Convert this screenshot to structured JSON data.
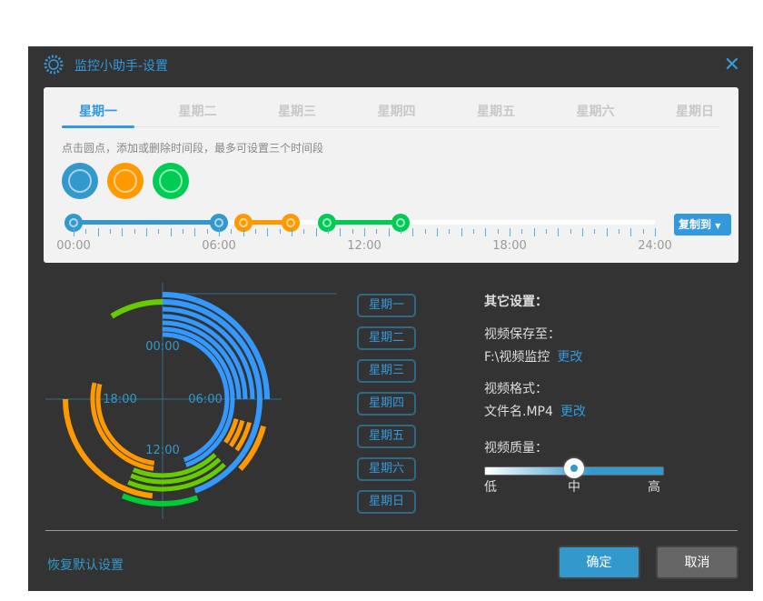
{
  "window": {
    "title": "监控小助手-设置",
    "icon": "gear-icon",
    "close_icon": "close-icon"
  },
  "tabs": [
    {
      "label": "星期一",
      "active": true
    },
    {
      "label": "星期二"
    },
    {
      "label": "星期三"
    },
    {
      "label": "星期四"
    },
    {
      "label": "星期五"
    },
    {
      "label": "星期六"
    },
    {
      "label": "星期日"
    }
  ],
  "hint": "点击圆点，添加或删除时间段，最多可设置三个时间段",
  "colors": {
    "accent": "#3399dd",
    "blue": "#3399cc",
    "orange": "#ff9900",
    "green": "#00cc55",
    "ring_blue": "#3399ff",
    "ring_orange": "#ff9900",
    "ring_lime": "#66cc00",
    "ring_green": "#00cc33"
  },
  "period_dots": [
    {
      "color": "#3399cc"
    },
    {
      "color": "#ff9900"
    },
    {
      "color": "#00cc55"
    }
  ],
  "timeline": {
    "segments": [
      {
        "start": 0,
        "end": 6,
        "color": "#3399cc"
      },
      {
        "start": 7,
        "end": 8.95,
        "color": "#ff9900"
      },
      {
        "start": 10.45,
        "end": 13.5,
        "color": "#00cc55"
      }
    ],
    "labels": [
      "00:00",
      "06:00",
      "12:00",
      "18:00",
      "24:00"
    ]
  },
  "copy_button": "复制到",
  "chart_data": {
    "type": "radial-schedule",
    "center_labels": [
      "00:00",
      "06:00",
      "12:00",
      "18:00"
    ],
    "rings": [
      {
        "day": "星期一",
        "arcs": [
          {
            "start": 0,
            "end": 6,
            "color": "#3399ff"
          },
          {
            "start": 7,
            "end": 8.8,
            "color": "#ff9900"
          },
          {
            "start": 10.7,
            "end": 13.5,
            "color": "#00cc33"
          }
        ]
      },
      {
        "day": "星期二",
        "arcs": [
          {
            "start": 0,
            "end": 10.7,
            "color": "#3399ff"
          },
          {
            "start": 12.4,
            "end": 18,
            "color": "#ff9900"
          },
          {
            "start": 21.9,
            "end": 24,
            "color": "#66cc00"
          }
        ]
      },
      {
        "day": "星期三",
        "arcs": [
          {
            "start": 0,
            "end": 6,
            "color": "#3399ff"
          },
          {
            "start": 7,
            "end": 8.3,
            "color": "#ff9900"
          },
          {
            "start": 9.1,
            "end": 13.5,
            "color": "#66cc00"
          }
        ]
      },
      {
        "day": "星期四",
        "arcs": [
          {
            "start": 0,
            "end": 6,
            "color": "#3399ff"
          },
          {
            "start": 7,
            "end": 8.3,
            "color": "#ff9900"
          },
          {
            "start": 9.1,
            "end": 13.5,
            "color": "#66cc00"
          }
        ]
      },
      {
        "day": "星期五",
        "arcs": [
          {
            "start": 0,
            "end": 6,
            "color": "#3399ff"
          },
          {
            "start": 7,
            "end": 8.3,
            "color": "#ff9900"
          },
          {
            "start": 9.1,
            "end": 13.5,
            "color": "#66cc00"
          }
        ]
      },
      {
        "day": "星期六",
        "arcs": [
          {
            "start": 0,
            "end": 10.7,
            "color": "#3399ff"
          },
          {
            "start": 12.5,
            "end": 18.9,
            "color": "#ff9900"
          }
        ]
      },
      {
        "day": "星期日",
        "arcs": [
          {
            "start": 0,
            "end": 10.7,
            "color": "#3399ff"
          },
          {
            "start": 12.5,
            "end": 18.9,
            "color": "#ff9900"
          }
        ]
      }
    ]
  },
  "day_buttons": [
    "星期一",
    "星期二",
    "星期三",
    "星期四",
    "星期五",
    "星期六",
    "星期日"
  ],
  "other": {
    "heading": "其它设置：",
    "save_label": "视频保存至：",
    "save_path": "F:\\视频监控",
    "change": "更改",
    "format_label": "视频格式：",
    "format_value": "文件名.MP4",
    "quality_label": "视频质量：",
    "quality_value": 0.5,
    "quality_levels": [
      "低",
      "中",
      "高"
    ]
  },
  "footer": {
    "restore": "恢复默认设置",
    "ok": "确定",
    "cancel": "取消"
  }
}
